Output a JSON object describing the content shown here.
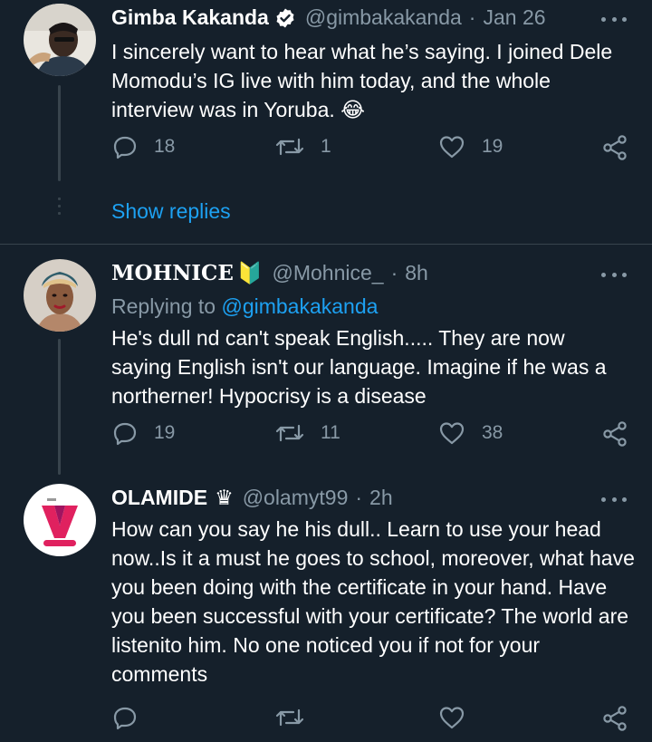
{
  "tweets": [
    {
      "name": "Gimba Kakanda",
      "verified": true,
      "handle": "@gimbakakanda",
      "separator": "·",
      "time": "Jan 26",
      "text": "I sincerely want to hear what he’s saying. I joined Dele Momodu’s IG live with him today, and the whole interview was in Yoruba. 😂",
      "replies": "18",
      "retweets": "1",
      "likes": "19",
      "show_replies": "Show replies"
    },
    {
      "name": "MOHNICE",
      "name_emoji": "🔰",
      "handle": "@Mohnice_",
      "separator": "·",
      "time": "8h",
      "replying_prefix": "Replying to",
      "replying_to": "@gimbakakanda",
      "text": "He's dull nd can't speak English..... They are now saying English isn't our language.  Imagine if he was a northerner! Hypocrisy is a disease",
      "replies": "19",
      "retweets": "11",
      "likes": "38"
    },
    {
      "name": "OLAMIDE",
      "name_emoji": "♛",
      "handle": "@olamyt99",
      "separator": "·",
      "time": "2h",
      "text": "How can you say he his dull.. Learn to use your head now..Is it a must he goes to school, moreover, what have you been doing with the certificate in your hand. Have you been successful with your certificate? The world are listenito him. No one noticed you if not for your comments",
      "replies": "",
      "retweets": "",
      "likes": ""
    }
  ],
  "colors": {
    "background": "#15202b",
    "text": "#ffffff",
    "secondary": "#8899a6",
    "link": "#1da1f2",
    "divider": "#38444d"
  },
  "icons": [
    "reply-icon",
    "retweet-icon",
    "like-icon",
    "share-icon",
    "more-icon",
    "verified-badge-icon"
  ]
}
